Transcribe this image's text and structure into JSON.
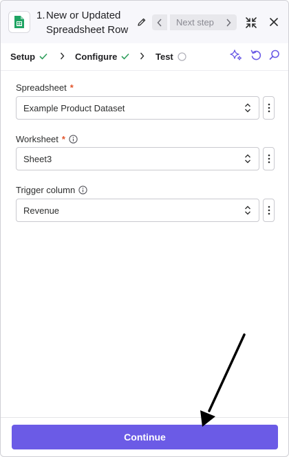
{
  "header": {
    "app_icon": "google-sheets-icon",
    "step_number": "1.",
    "title": "New or Updated Spreadsheet Row",
    "next_step_label": "Next step"
  },
  "steps": [
    {
      "label": "Setup",
      "status": "complete"
    },
    {
      "label": "Configure",
      "status": "complete"
    },
    {
      "label": "Test",
      "status": "pending"
    }
  ],
  "fields": {
    "spreadsheet": {
      "label": "Spreadsheet",
      "required_mark": "*",
      "value": "Example Product Dataset"
    },
    "worksheet": {
      "label": "Worksheet",
      "required_mark": "*",
      "value": "Sheet3"
    },
    "trigger_column": {
      "label": "Trigger column",
      "value": "Revenue"
    }
  },
  "footer": {
    "continue_label": "Continue"
  },
  "colors": {
    "accent": "#6b5be6",
    "check": "#2e9e5b",
    "required": "#e2542b"
  }
}
